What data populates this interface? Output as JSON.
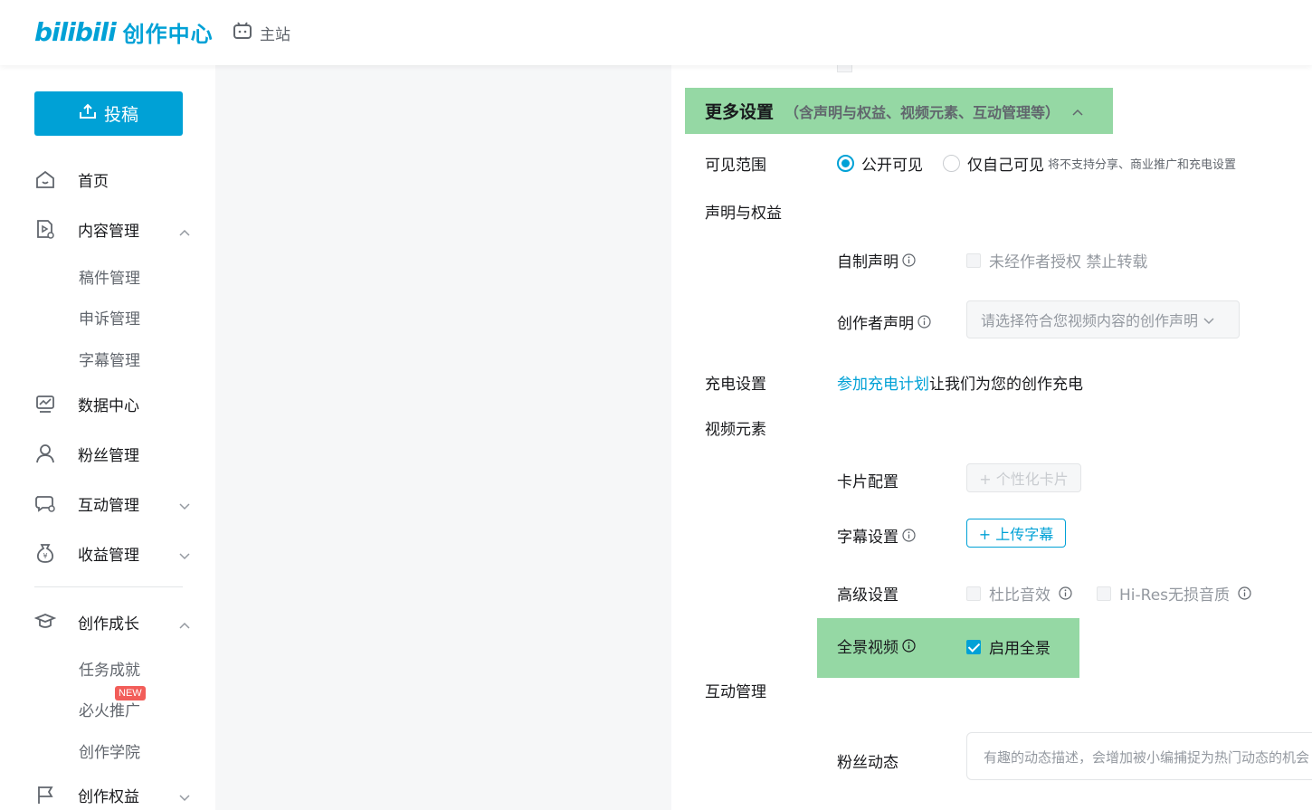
{
  "header": {
    "logo_mark": "bilibili",
    "logo_text": "创作中心",
    "main_site": "主站"
  },
  "sidebar": {
    "upload": "投稿",
    "home": "首页",
    "content": "内容管理",
    "content_sub": [
      "稿件管理",
      "申诉管理",
      "字幕管理"
    ],
    "data": "数据中心",
    "fans": "粉丝管理",
    "interact": "互动管理",
    "income": "收益管理",
    "growth": "创作成长",
    "growth_sub": [
      "任务成就",
      "必火推广",
      "创作学院"
    ],
    "new_badge": "NEW",
    "rights": "创作权益"
  },
  "form": {
    "more_title": "更多设置",
    "more_sub": "（含声明与权益、视频元素、互动管理等）",
    "visibility_label": "可见范围",
    "vis_public": "公开可见",
    "vis_private": "仅自己可见",
    "vis_note": "将不支持分享、商业推广和充电设置",
    "rights_label": "声明与权益",
    "self_made_label": "自制声明",
    "self_made_option": "未经作者授权 禁止转载",
    "creator_decl_label": "创作者声明",
    "creator_decl_placeholder": "请选择符合您视频内容的创作声明",
    "charge_label": "充电设置",
    "charge_link": "参加充电计划",
    "charge_text": "让我们为您的创作充电",
    "video_elements_label": "视频元素",
    "card_label": "卡片配置",
    "card_button": "+ 个性化卡片",
    "subtitle_label": "字幕设置",
    "subtitle_button": "+ 上传字幕",
    "advanced_label": "高级设置",
    "dolby": "杜比音效",
    "hires": "Hi-Res无损音质",
    "panorama_label": "全景视频",
    "panorama_option": "启用全景",
    "interact_label": "互动管理",
    "fan_dynamic_label": "粉丝动态",
    "fan_dynamic_placeholder": "有趣的动态描述，会增加被小编捕捉为热门动态的机会"
  },
  "colors": {
    "accent": "#00a1d6",
    "highlight": "#95d8a4",
    "badge": "#f25d59"
  }
}
